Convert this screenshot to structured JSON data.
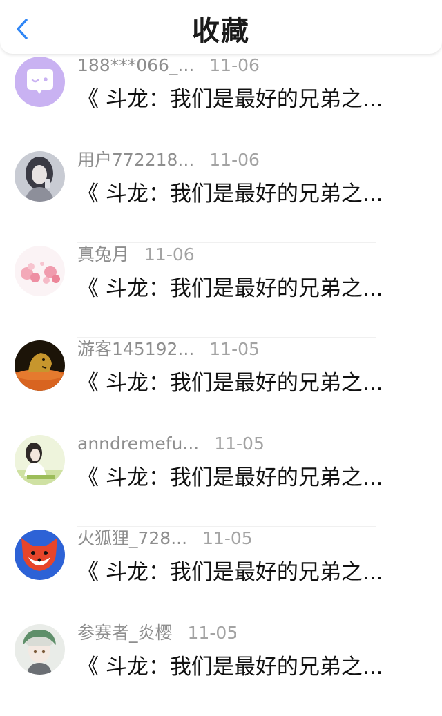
{
  "header": {
    "title": "收藏",
    "back_icon": "chevron-left-icon",
    "accent_color": "#2f86f6"
  },
  "favorites": [
    {
      "user": "188***066_...",
      "date": "11-06",
      "title": "《 斗龙：我们是最好的兄弟之...",
      "avatar": "chat-bubble-avatar"
    },
    {
      "user": "用户772218...",
      "date": "11-06",
      "title": "《 斗龙：我们是最好的兄弟之...",
      "avatar": "girl-photo-avatar"
    },
    {
      "user": "真兔月",
      "date": "11-06",
      "title": "《 斗龙：我们是最好的兄弟之...",
      "avatar": "cherry-blossom-avatar"
    },
    {
      "user": "游客145192...",
      "date": "11-05",
      "title": "《 斗龙：我们是最好的兄弟之...",
      "avatar": "cougar-avatar"
    },
    {
      "user": "anndremefu...",
      "date": "11-05",
      "title": "《 斗龙：我们是最好的兄弟之...",
      "avatar": "girl-sketch-avatar"
    },
    {
      "user": "火狐狸_728...",
      "date": "11-05",
      "title": "《 斗龙：我们是最好的兄弟之...",
      "avatar": "fox-avatar"
    },
    {
      "user": "参赛者_炎樱",
      "date": "11-05",
      "title": "《 斗龙：我们是最好的兄弟之...",
      "avatar": "anime-character-avatar"
    }
  ]
}
